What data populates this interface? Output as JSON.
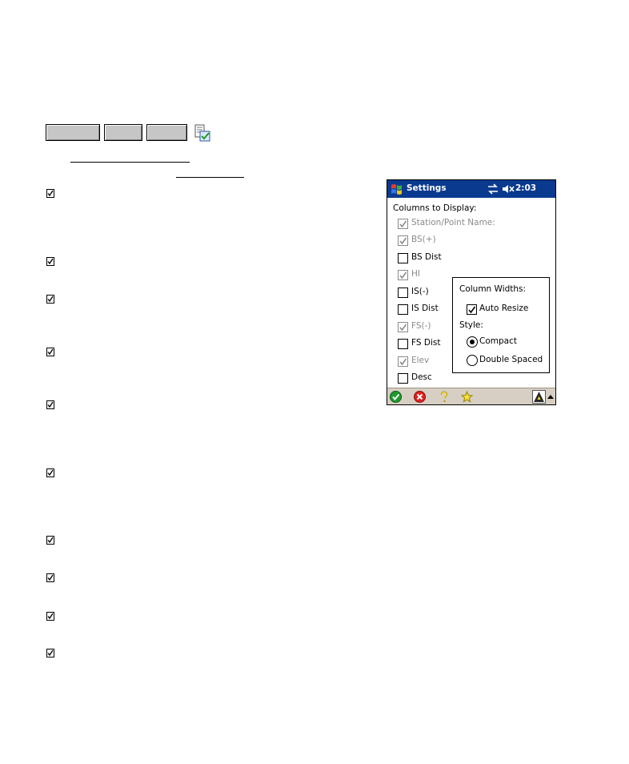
{
  "header_tabs": [
    "",
    "",
    ""
  ],
  "pda": {
    "title": "Settings",
    "clock": "2:03",
    "columns_heading": "Columns to Display:",
    "columns": [
      {
        "label": "Station/Point Name:",
        "checked": true,
        "enabled": false
      },
      {
        "label": "BS(+)",
        "checked": true,
        "enabled": false
      },
      {
        "label": "BS Dist",
        "checked": false,
        "enabled": true
      },
      {
        "label": "HI",
        "checked": true,
        "enabled": false
      },
      {
        "label": "IS(-)",
        "checked": false,
        "enabled": true
      },
      {
        "label": "IS Dist",
        "checked": false,
        "enabled": true
      },
      {
        "label": "FS(-)",
        "checked": true,
        "enabled": false
      },
      {
        "label": "FS Dist",
        "checked": false,
        "enabled": true
      },
      {
        "label": "Elev",
        "checked": true,
        "enabled": false
      },
      {
        "label": "Desc",
        "checked": false,
        "enabled": true
      }
    ],
    "column_widths_label": "Column Widths:",
    "auto_resize_label": "Auto Resize",
    "auto_resize_checked": true,
    "style_label": "Style:",
    "style_options": [
      "Compact",
      "Double Spaced"
    ],
    "style_selected": "Compact",
    "toolbar_icons": [
      "ok-icon",
      "cancel-icon",
      "help-icon",
      "favorite-star-icon"
    ],
    "titlebar_color": "#0a3a8f",
    "cmdbar_color": "#d7cfc3"
  },
  "left_checklist_count": 10
}
